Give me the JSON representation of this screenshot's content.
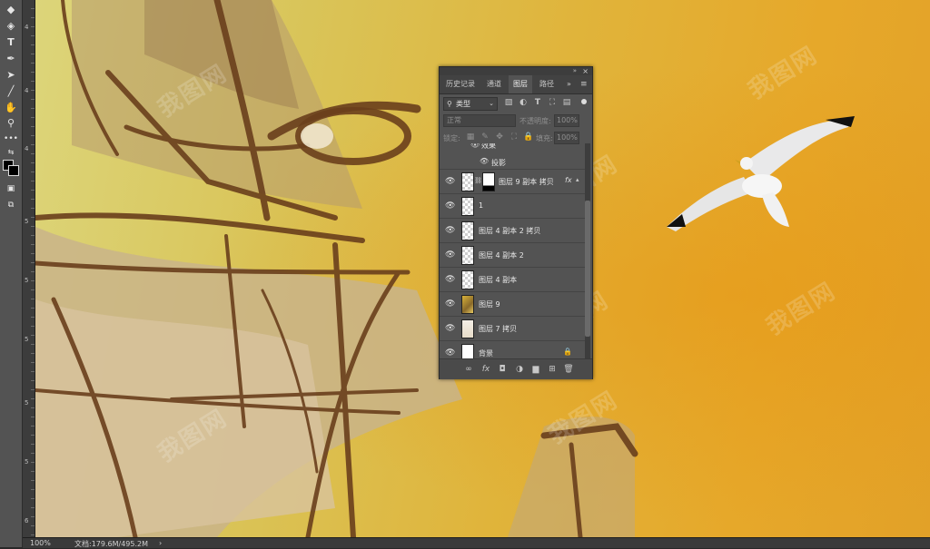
{
  "panel": {
    "tabs": [
      {
        "label": "历史记录",
        "active": false
      },
      {
        "label": "通道",
        "active": false
      },
      {
        "label": "图层",
        "active": true
      },
      {
        "label": "路径",
        "active": false
      }
    ],
    "filter_label": "类型",
    "blend_mode": "正常",
    "opacity_label": "不透明度:",
    "opacity_value": "100%",
    "lock_label": "锁定:",
    "fill_label": "填充:",
    "fill_value": "100%",
    "effects_label": "效果",
    "effect_item": "投影",
    "fx_label": "fx",
    "layers": [
      {
        "name": "图层 9 副本 拷贝",
        "has_fx": true,
        "thumb": "mask"
      },
      {
        "name": "1",
        "thumb": "transparent"
      },
      {
        "name": "图层 4 副本 2 拷贝",
        "thumb": "transparent"
      },
      {
        "name": "图层 4 副本 2",
        "thumb": "transparent"
      },
      {
        "name": "图层 4 副本",
        "thumb": "transparent"
      },
      {
        "name": "图层 9",
        "thumb": "image"
      },
      {
        "name": "图层 7 拷贝",
        "thumb": "light"
      },
      {
        "name": "背景",
        "thumb": "white",
        "locked": true
      }
    ]
  },
  "status": {
    "zoom": "100%",
    "doc_info": "文档:179.6M/495.2M"
  },
  "ruler": {
    "labels": [
      "4",
      "4",
      "4",
      "5",
      "5",
      "5",
      "5",
      "5",
      "6"
    ]
  },
  "canvas": {
    "watermark": "我图网"
  },
  "colors": {
    "panel_bg": "#535353",
    "toolbar_bg": "#535353",
    "canvas_yellow": "#dcc85a",
    "canvas_orange": "#e6a82a"
  }
}
